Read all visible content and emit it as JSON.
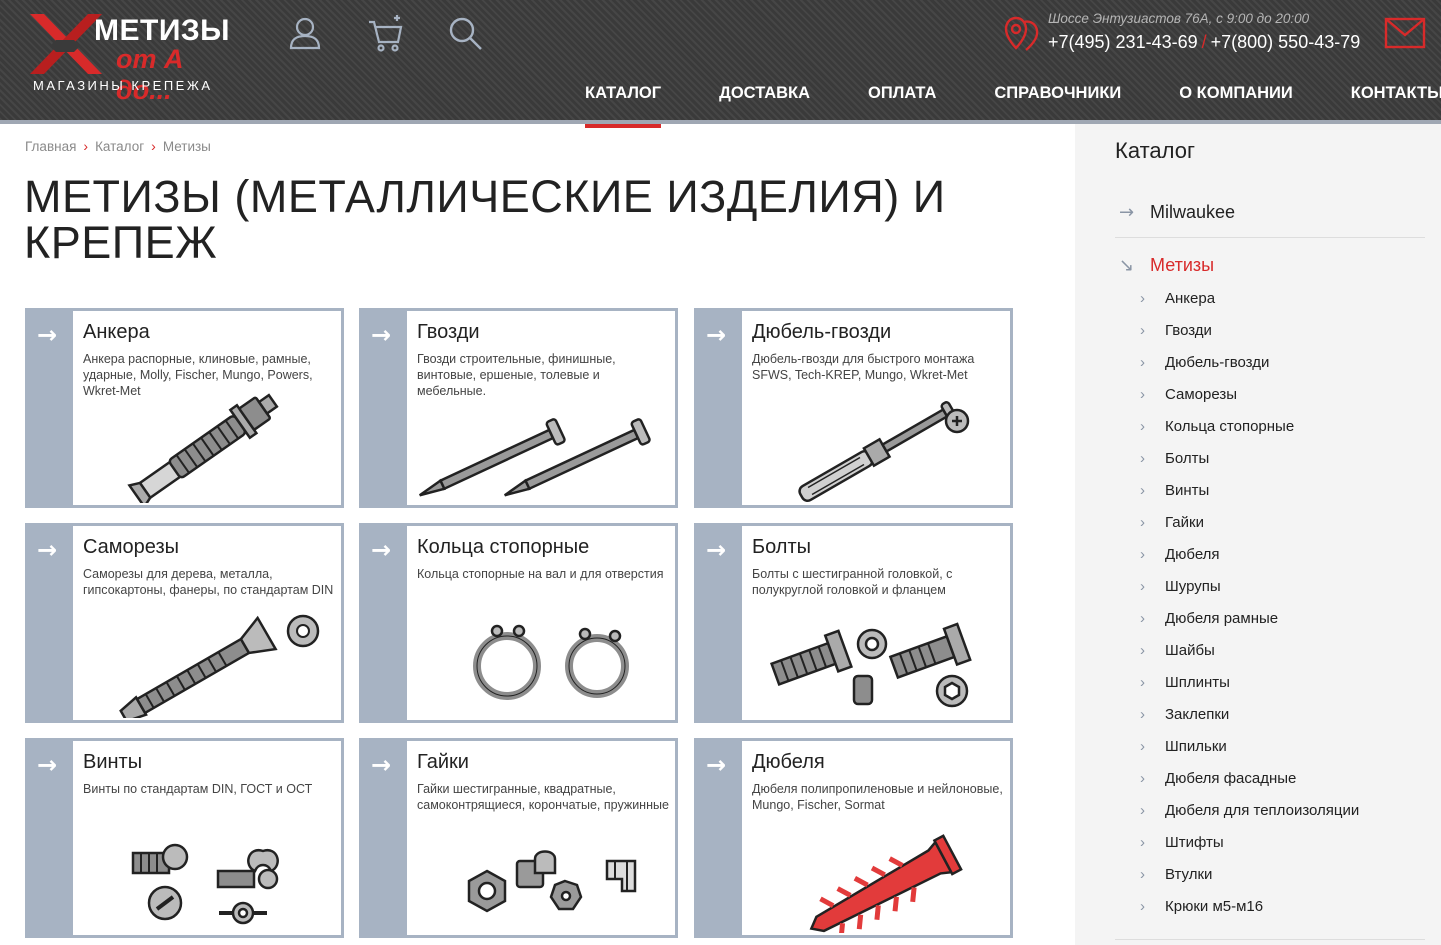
{
  "logo": {
    "title": "МЕТИЗЫ",
    "subtitle": "от А до...",
    "tagline": "МАГАЗИНЫ КРЕПЕЖА"
  },
  "header": {
    "address": "Шоссе Энтузиастов 76А, с 9:00 до 20:00",
    "phone1": "+7(495) 231-43-69",
    "phone_sep": "/",
    "phone2": "+7(800) 550-43-79",
    "icons": [
      "user-icon",
      "cart-icon",
      "search-icon",
      "location-icon",
      "mail-icon"
    ]
  },
  "nav": [
    {
      "label": "КАТАЛОГ",
      "active": true
    },
    {
      "label": "ДОСТАВКА"
    },
    {
      "label": "ОПЛАТА"
    },
    {
      "label": "СПРАВОЧНИКИ"
    },
    {
      "label": "О КОМПАНИИ"
    },
    {
      "label": "КОНТАКТЫ"
    }
  ],
  "breadcrumb": [
    "Главная",
    "Каталог",
    "Метизы"
  ],
  "page_title": "МЕТИЗЫ (МЕТАЛЛИЧЕСКИЕ ИЗДЕЛИЯ) И КРЕПЕЖ",
  "cards": [
    {
      "title": "Анкера",
      "desc": "Анкера распорные, клиновые, рамные, ударные, Molly, Fischer, Mungo, Powers, Wkret-Met"
    },
    {
      "title": "Гвозди",
      "desc": "Гвозди строительные, финишные, винтовые, ершеные, толевые и мебельные."
    },
    {
      "title": "Дюбель-гвозди",
      "desc": "Дюбель-гвозди для быстрого монтажа SFWS, Tech-KREP, Mungo, Wkret-Met"
    },
    {
      "title": "Саморезы",
      "desc": "Саморезы для дерева, металла, гипсокартоны, фанеры, по стандартам DIN"
    },
    {
      "title": "Кольца стопорные",
      "desc": "Кольца стопорные на вал и для отверстия"
    },
    {
      "title": "Болты",
      "desc": "Болты с шестигранной головкой, с полукруглой головкой и фланцем"
    },
    {
      "title": "Винты",
      "desc": "Винты по стандартам DIN, ГОСТ и ОСТ"
    },
    {
      "title": "Гайки",
      "desc": "Гайки шестигранные, квадратные, самоконтрящиеся, корончатые, пружинные"
    },
    {
      "title": "Дюбеля",
      "desc": "Дюбеля полипропиленовые и нейлоновые, Mungo, Fischer, Sormat"
    }
  ],
  "sidebar": {
    "title": "Каталог",
    "top_item": "Milwaukee",
    "active_item": "Метизы",
    "items": [
      "Анкера",
      "Гвозди",
      "Дюбель-гвозди",
      "Саморезы",
      "Кольца стопорные",
      "Болты",
      "Винты",
      "Гайки",
      "Дюбеля",
      "Шурупы",
      "Дюбеля рамные",
      "Шайбы",
      "Шплинты",
      "Заклепки",
      "Шпильки",
      "Дюбеля фасадные",
      "Дюбеля для теплоизоляции",
      "Штифты",
      "Втулки",
      "Крюки м5-м16"
    ]
  },
  "colors": {
    "accent": "#d82a2a",
    "strip": "#a7b3c3",
    "header_bg": "#3a3a3a"
  }
}
